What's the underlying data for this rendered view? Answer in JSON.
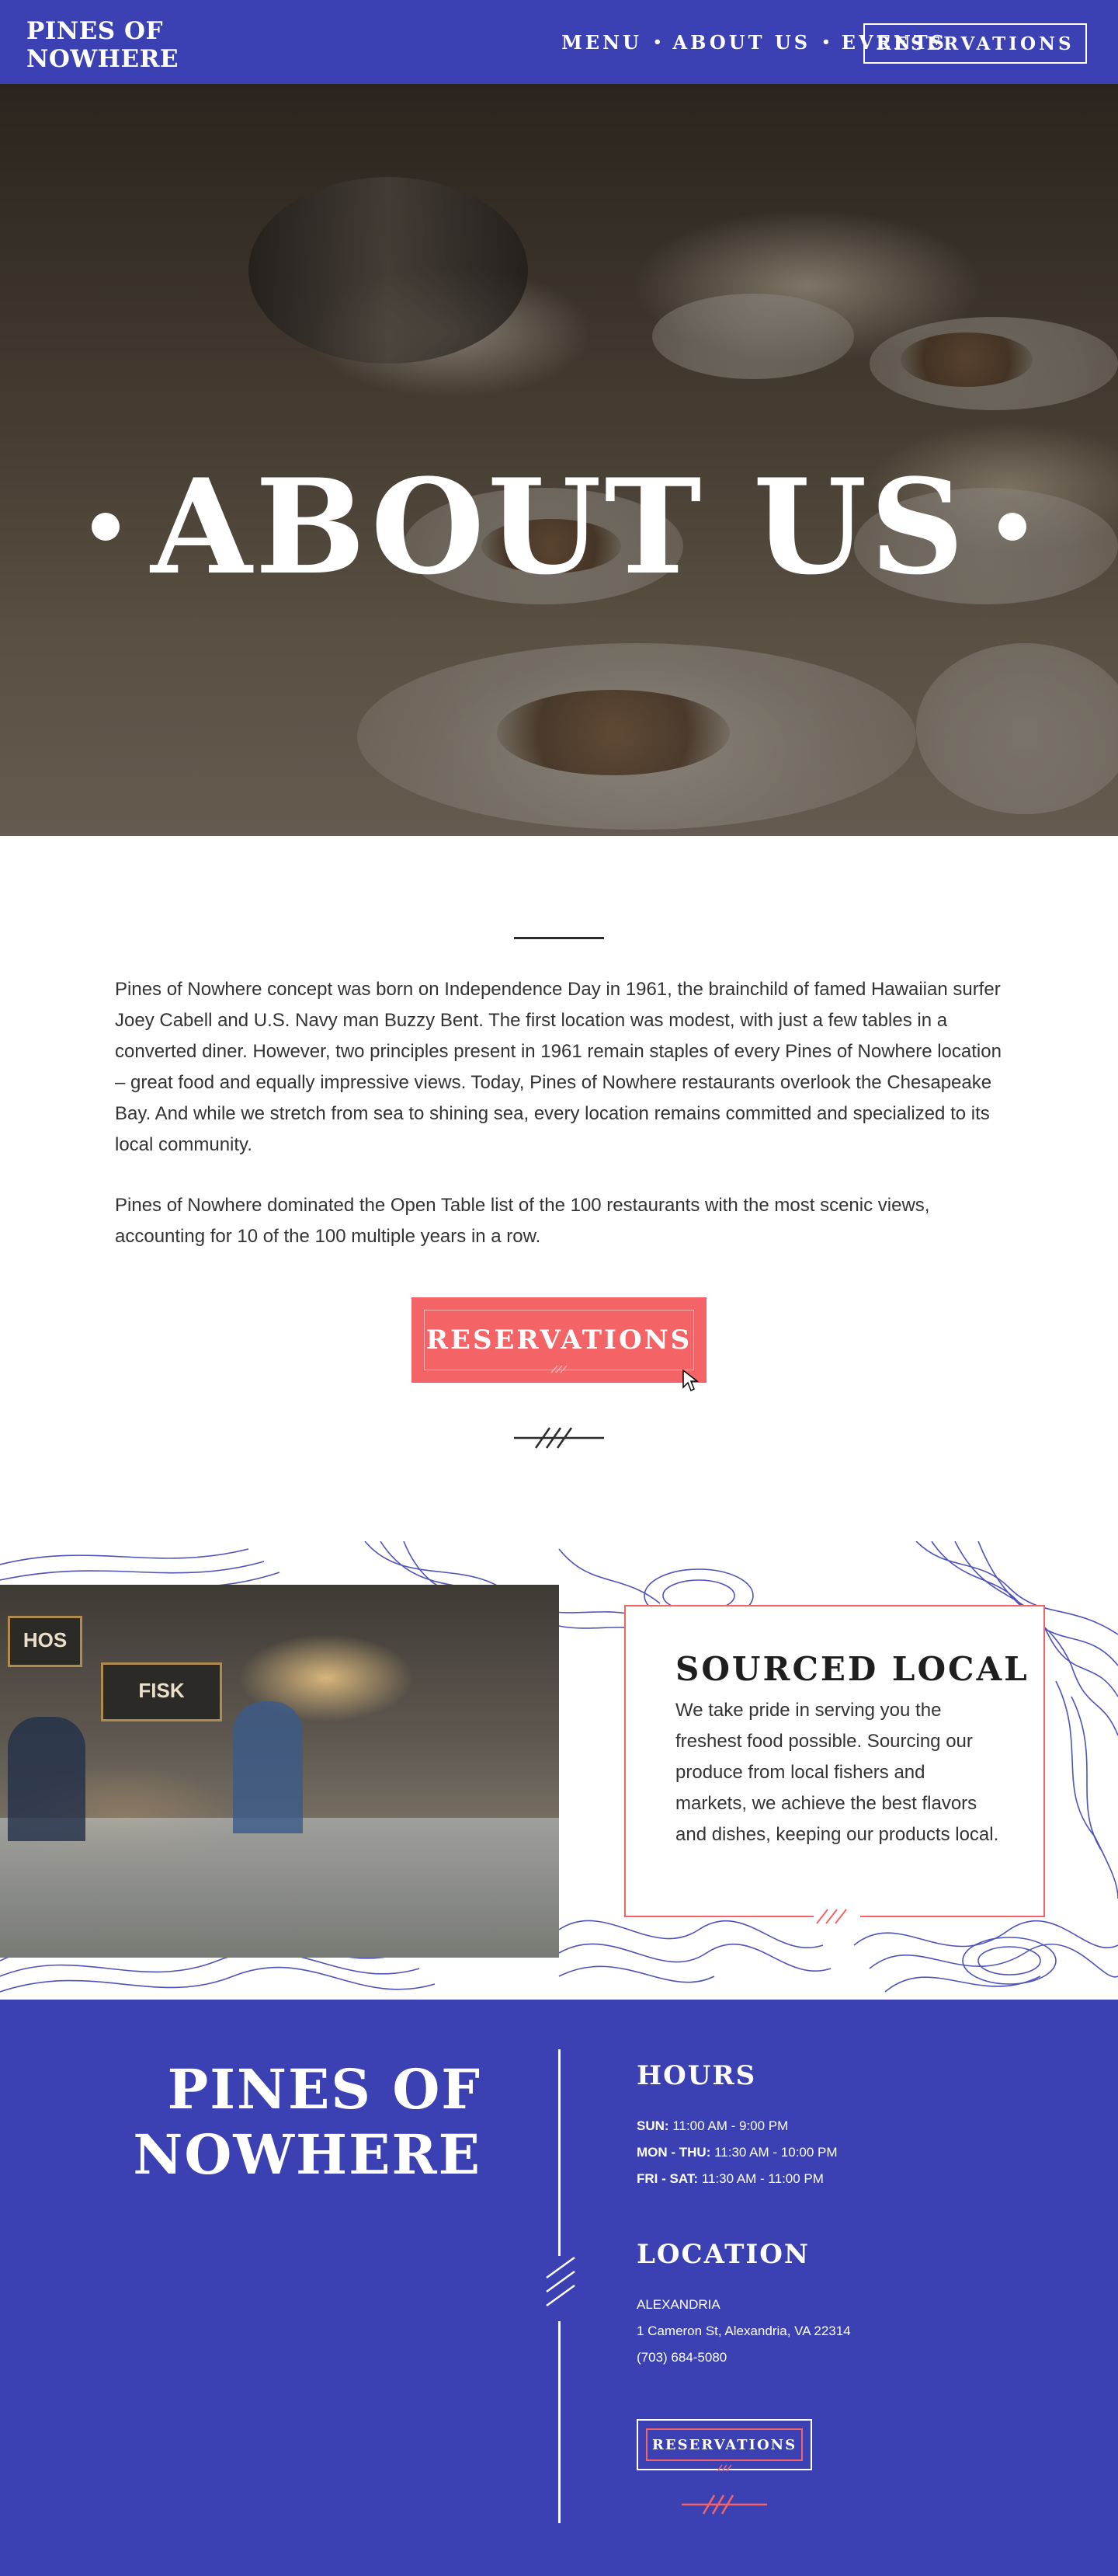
{
  "header": {
    "logo_line1": "PINES OF",
    "logo_line2": "NOWHERE",
    "nav": [
      {
        "label": "MENU"
      },
      {
        "label": "ABOUT US"
      },
      {
        "label": "EVENTS"
      }
    ],
    "nav_separator": "•",
    "reservations_label": "RESERVATIONS"
  },
  "hero": {
    "title": "ABOUT US"
  },
  "intro": {
    "paragraph1": "Pines of Nowhere concept was born on Independence Day in 1961, the brainchild of famed Hawaiian surfer Joey Cabell and U.S. Navy man Buzzy Bent. The first location was modest, with just a few tables in a converted diner. However, two principles present in 1961 remain staples of every Pines of Nowhere location – great food and equally impressive views. Today, Pines of Nowhere restaurants overlook the Chesapeake Bay. And while we stretch from sea to shining sea, every location remains committed and specialized to its local community.",
    "paragraph2": "Pines of Nowhere dominated the Open Table list of the 100 restaurants with the most scenic views, accounting for 10 of the 100 multiple years in a row.",
    "cta_label": "RESERVATIONS"
  },
  "sourced_local": {
    "title": "SOURCED LOCAL",
    "text": "We take pride in serving you the freshest food possible. Sourcing our produce from local fishers and markets, we achieve the best flavors and dishes, keeping our products local.",
    "market_signs": [
      "HOS",
      "FISK"
    ]
  },
  "footer": {
    "logo_line1": "PINES OF",
    "logo_line2": "NOWHERE",
    "hours_title": "HOURS",
    "hours": [
      {
        "days": "SUN:",
        "time": "11:00 AM - 9:00 PM"
      },
      {
        "days": "MON - THU:",
        "time": "11:30 AM - 10:00 PM"
      },
      {
        "days": "FRI - SAT:",
        "time": "11:30 AM - 11:00 PM"
      }
    ],
    "location_title": "LOCATION",
    "location_city": "ALEXANDRIA",
    "location_address": "1 Cameron St, Alexandria, VA 22314",
    "location_phone": "(703) 684-5080",
    "reservations_label": "RESERVATIONS"
  },
  "colors": {
    "brand_blue": "#3b41b3",
    "accent_coral": "#f46466",
    "contour_blue": "#3b41b3"
  }
}
